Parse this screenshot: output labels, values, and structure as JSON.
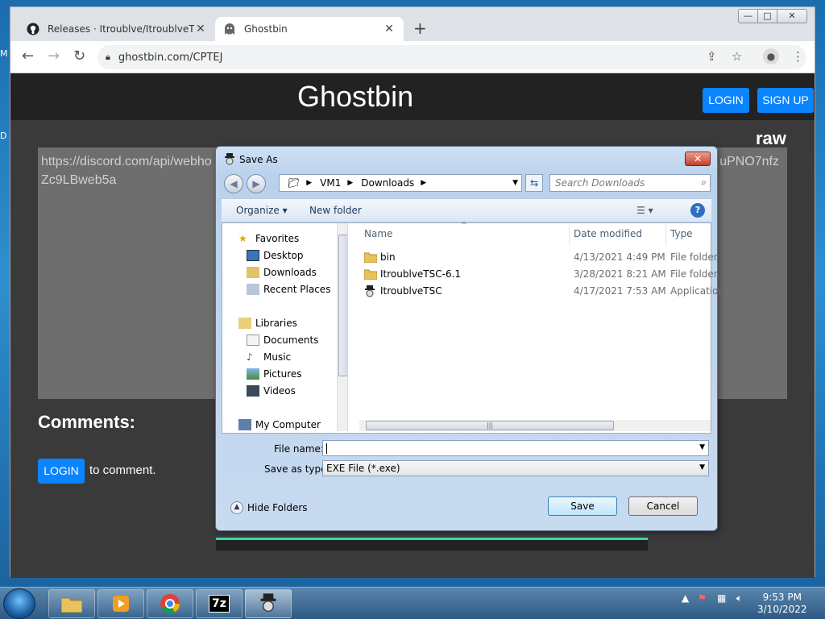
{
  "desktop": {
    "glyph_m": "M",
    "glyph_d": "D"
  },
  "browser": {
    "window_controls": {
      "minimize": "—",
      "maximize": "□",
      "close": "✕"
    },
    "tabs": [
      {
        "title": "Releases · Itroublve/ItroublveTSC",
        "icon": "github-icon",
        "active": false
      },
      {
        "title": "Ghostbin",
        "icon": "ghost-icon",
        "active": true
      }
    ],
    "new_tab": "+",
    "url": "ghostbin.com/CPTEJ"
  },
  "page": {
    "logo": "Ghostbin",
    "login": "LOGIN",
    "signup": "SIGN UP",
    "raw": "raw",
    "paste_line1_left": "https://discord.com/api/webho",
    "paste_line1_right": "uPNO7nfz",
    "paste_line2": "Zc9LBweb5a",
    "comments": "Comments:",
    "comment_login": "LOGIN",
    "to_comment": "to comment."
  },
  "dialog": {
    "title": "Save As",
    "path": [
      "VM1",
      "Downloads"
    ],
    "search_placeholder": "Search Downloads",
    "organize": "Organize ▾",
    "new_folder": "New folder",
    "nav": {
      "favorites": "Favorites",
      "desktop": "Desktop",
      "downloads": "Downloads",
      "recent": "Recent Places",
      "libraries": "Libraries",
      "documents": "Documents",
      "music": "Music",
      "pictures": "Pictures",
      "videos": "Videos",
      "my_computer": "My Computer"
    },
    "columns": {
      "name": "Name",
      "date": "Date modified",
      "type": "Type"
    },
    "files": [
      {
        "name": "bin",
        "date": "4/13/2021 4:49 PM",
        "type": "File folder",
        "kind": "folder"
      },
      {
        "name": "ItroublveTSC-6.1",
        "date": "3/28/2021 8:21 AM",
        "type": "File folder",
        "kind": "folder"
      },
      {
        "name": "ItroublveTSC",
        "date": "4/17/2021 7:53 AM",
        "type": "Application",
        "kind": "app"
      }
    ],
    "file_name_label": "File name:",
    "file_name_value": "",
    "save_type_label": "Save as type:",
    "save_type_value": "EXE File (*.exe)",
    "hide_folders": "Hide Folders",
    "save": "Save",
    "cancel": "Cancel"
  },
  "taskbar": {
    "time": "9:53 PM",
    "date": "3/10/2022"
  }
}
